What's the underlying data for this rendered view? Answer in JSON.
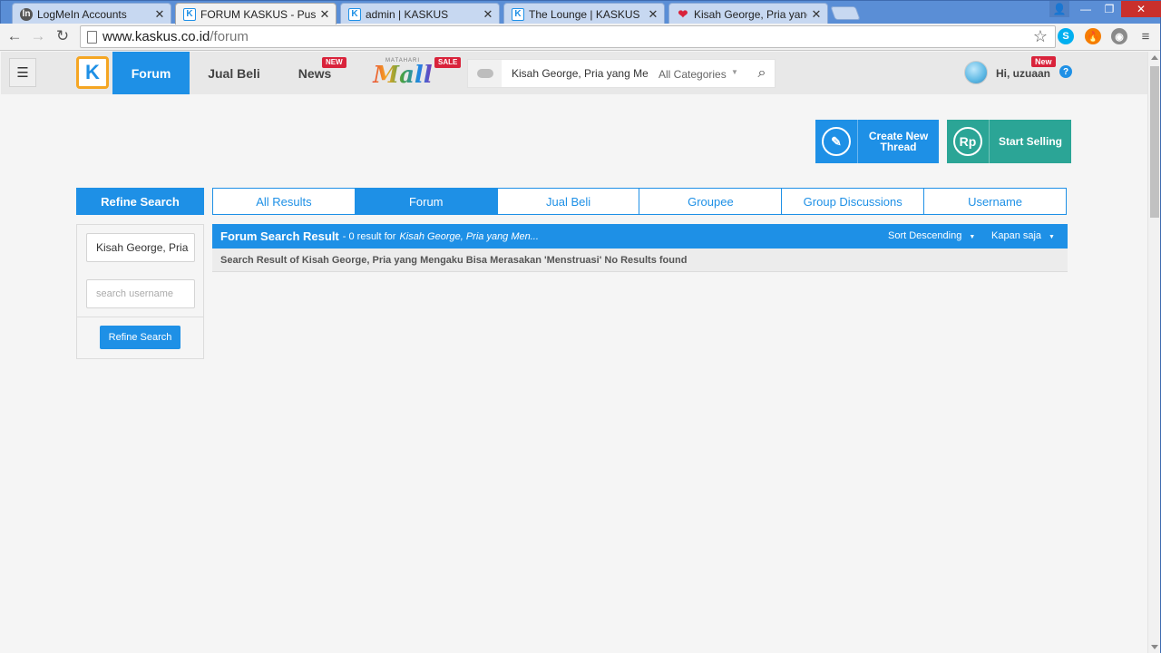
{
  "browser": {
    "tabs": [
      {
        "title": "LogMeIn Accounts",
        "favicon": "logmein-icon"
      },
      {
        "title": "FORUM KASKUS - Pusat D",
        "favicon": "kaskus-icon"
      },
      {
        "title": "admin | KASKUS",
        "favicon": "kaskus-icon"
      },
      {
        "title": "The Lounge | KASKUS",
        "favicon": "kaskus-icon"
      },
      {
        "title": "Kisah George, Pria yang M",
        "favicon": "heart-icon"
      }
    ],
    "url_host": "www.kaskus.co.id",
    "url_path": "/forum"
  },
  "header": {
    "logo": "K",
    "nav": [
      {
        "label": "Forum"
      },
      {
        "label": "Jual Beli"
      },
      {
        "label": "News",
        "badge": "NEW"
      }
    ],
    "mall": {
      "top": "MATAHARI",
      "word": "Mall",
      "badge": "SALE"
    },
    "search": {
      "query": "Kisah George, Pria yang Me",
      "category": "All Categories"
    },
    "user": {
      "greeting": "Hi, uzuaan",
      "badge": "New",
      "help": "?"
    }
  },
  "actions": {
    "create_thread": "Create New Thread",
    "start_selling": "Start Selling",
    "rp": "Rp"
  },
  "sidebar": {
    "title": "Refine Search",
    "query_value": "Kisah George, Pria",
    "username_placeholder": "search username",
    "button": "Refine Search"
  },
  "result_tabs": [
    "All Results",
    "Forum",
    "Jual Beli",
    "Groupee",
    "Group Discussions",
    "Username"
  ],
  "results": {
    "title": "Forum Search Result",
    "count_text": "- 0 result for",
    "query": "Kisah George, Pria yang Men...",
    "sort": "Sort Descending",
    "time": "Kapan saja",
    "message": "Search Result of Kisah George, Pria yang Mengaku Bisa Merasakan 'Menstruasi' No Results found"
  },
  "colors": {
    "primary": "#1e90e6",
    "selling": "#2ba596",
    "badge": "#d9233b",
    "logo_border": "#f5a623"
  }
}
